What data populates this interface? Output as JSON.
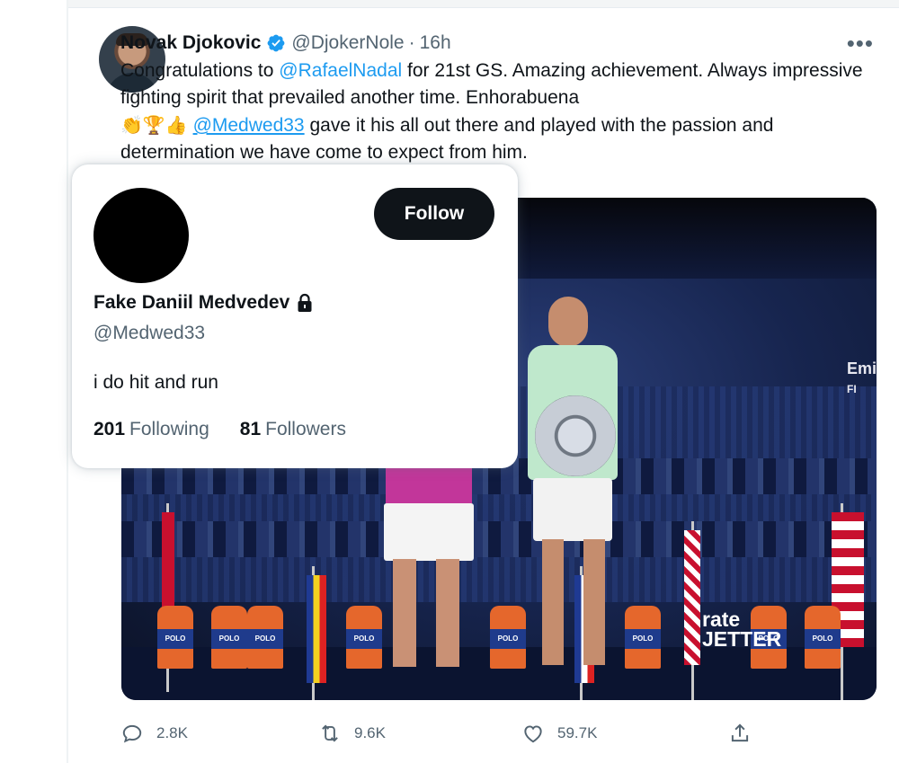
{
  "tweet": {
    "author_name": "Novak Djokovic",
    "author_handle": "@DjokerNole",
    "separator": "·",
    "time": "16h",
    "more_label": "•••",
    "text": {
      "part1": "Congratulations to ",
      "mention1": "@RafaelNadal",
      "part2": " for 21st GS. Amazing achievement. Always impressive fighting spirit that prevailed another time. Enhorabuena ",
      "emojis": "👏🏆👍",
      "part3": "  ",
      "mention2": "@Medwed33",
      "part4": " gave it his all out there and played with the passion and determination we have come to expect from him."
    },
    "media": {
      "sign_left": "Emi",
      "sign_left_sub": "FI",
      "sign_rate": "rate",
      "sign_jetter": "JETTER",
      "polo_label": "POLO"
    },
    "actions": {
      "reply_count": "2.8K",
      "retweet_count": "9.6K",
      "like_count": "59.7K"
    }
  },
  "hover_card": {
    "follow_label": "Follow",
    "display_name": "Fake Daniil Medvedev",
    "handle": "@Medwed33",
    "bio": "i do hit and run",
    "following_count": "201",
    "following_label": "Following",
    "followers_count": "81",
    "followers_label": "Followers"
  },
  "colors": {
    "accent": "#1d9bf0",
    "text_primary": "#0f1419",
    "text_secondary": "#536471",
    "follow_button": "#0f1419"
  },
  "icons": [
    "verified-badge-icon",
    "more-icon",
    "lock-icon",
    "reply-icon",
    "retweet-icon",
    "like-icon",
    "share-icon"
  ]
}
